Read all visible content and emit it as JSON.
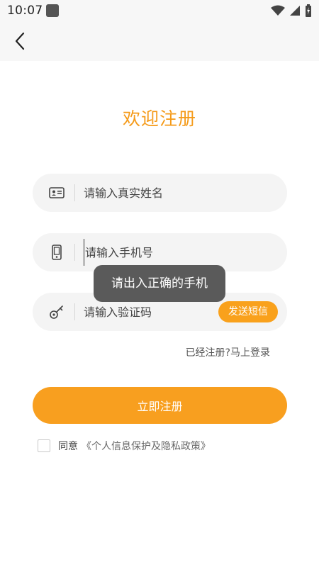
{
  "status_bar": {
    "time": "10:07"
  },
  "header": {
    "back_icon": "chevron-left-icon"
  },
  "page": {
    "title": "欢迎注册"
  },
  "form": {
    "name_field": {
      "placeholder": "请输入真实姓名",
      "icon": "id-card-icon"
    },
    "phone_field": {
      "placeholder": "请输入手机号",
      "icon": "phone-icon"
    },
    "code_field": {
      "placeholder": "请输入验证码",
      "icon": "key-icon"
    },
    "send_sms_label": "发送短信"
  },
  "toast": {
    "message": "请出入正确的手机"
  },
  "links": {
    "login": "已经注册?马上登录"
  },
  "actions": {
    "register_label": "立即注册"
  },
  "agreement": {
    "agree_text": "同意",
    "policy_text": "《个人信息保护及隐私政策》"
  },
  "colors": {
    "accent": "#f89f1f",
    "title": "#f59a18"
  }
}
